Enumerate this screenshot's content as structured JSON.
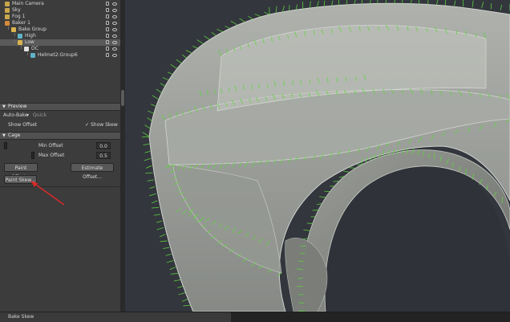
{
  "scene_tree": {
    "items": [
      {
        "label": "Main Camera",
        "depth": 0,
        "icon": "camera-icon",
        "color": "#c9a64a"
      },
      {
        "label": "Sky",
        "depth": 0,
        "icon": "sky-icon",
        "color": "#c9a64a"
      },
      {
        "label": "Fog 1",
        "depth": 0,
        "icon": "fog-icon",
        "color": "#c9a64a"
      },
      {
        "label": "Baker 1",
        "depth": 0,
        "icon": "baker-icon",
        "color": "#d48a3c"
      },
      {
        "label": "Bake Group",
        "depth": 1,
        "icon": "folder-icon",
        "color": "#d8b34e"
      },
      {
        "label": "High",
        "depth": 2,
        "icon": "mesh-icon",
        "color": "#5fb3c9"
      },
      {
        "label": "Low",
        "depth": 2,
        "icon": "mesh-icon",
        "color": "#d8b34e",
        "selected": true
      },
      {
        "label": "OC",
        "depth": 3,
        "icon": "cage-icon",
        "color": "#e0e0e0"
      },
      {
        "label": "Helmet2:Group6",
        "depth": 4,
        "icon": "mesh-icon",
        "color": "#5fb3c9"
      }
    ]
  },
  "preview": {
    "header": "Preview",
    "auto_bake_label": "Auto-Bake",
    "auto_bake_value": "Quick",
    "show_offset_label": "Show Offset",
    "show_skew_label": "Show Skew",
    "show_skew_check": "✓"
  },
  "cage": {
    "header": "Cage",
    "min_offset_label": "Min Offset",
    "min_offset_value": "0.0",
    "max_offset_label": "Max Offset",
    "max_offset_value": "0.5",
    "paint_offset_button": "Paint Offset...",
    "estimate_offset_button": "Estimate Offset...",
    "paint_skew_button": "Paint Skew..."
  },
  "status_bar": {
    "text": "Bake Skew"
  },
  "colors": {
    "panel": "#3c3c3c",
    "viewport": "#33363d",
    "skew_vectors": "#5ed33f",
    "annotation_arrow": "#d82a2a",
    "mesh": "#aeb1ab"
  }
}
